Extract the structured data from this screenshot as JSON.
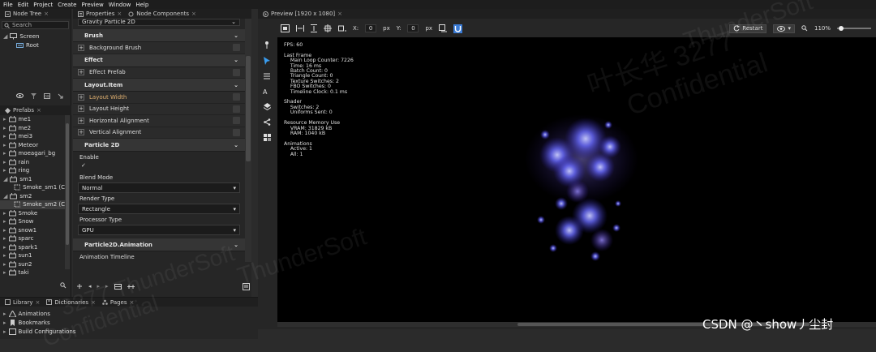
{
  "menubar": {
    "items": [
      "File",
      "Edit",
      "Project",
      "Create",
      "Preview",
      "Window",
      "Help"
    ]
  },
  "nodetree": {
    "tab_label": "Node Tree",
    "search_placeholder": "Search",
    "items": [
      "Screen",
      "Root"
    ]
  },
  "prefabs": {
    "tab_label": "Prefabs",
    "items": [
      {
        "label": "me1",
        "indent": 0
      },
      {
        "label": "me2",
        "indent": 0
      },
      {
        "label": "mei3",
        "indent": 0
      },
      {
        "label": "Meteor",
        "indent": 0
      },
      {
        "label": "moeagari_bg",
        "indent": 0
      },
      {
        "label": "rain",
        "indent": 0
      },
      {
        "label": "ring",
        "indent": 0
      },
      {
        "label": "sm1",
        "indent": 0
      },
      {
        "label": "Smoke_sm1 (C",
        "indent": 1
      },
      {
        "label": "sm2",
        "indent": 0
      },
      {
        "label": "Smoke_sm2 (C",
        "indent": 1
      },
      {
        "label": "Smoke",
        "indent": 0
      },
      {
        "label": "Snow",
        "indent": 0
      },
      {
        "label": "snow1",
        "indent": 0
      },
      {
        "label": "sparc",
        "indent": 0
      },
      {
        "label": "spark1",
        "indent": 0
      },
      {
        "label": "sun1",
        "indent": 0
      },
      {
        "label": "sun2",
        "indent": 0
      },
      {
        "label": "taki",
        "indent": 0
      }
    ]
  },
  "properties": {
    "tab_label": "Properties",
    "tab2_label": "Node Components",
    "top_select": "Gravity Particle 2D",
    "brush_header": "Brush",
    "background_brush": "Background Brush",
    "effect_header": "Effect",
    "effect_prefab": "Effect Prefab",
    "layout_header": "Layout.Item",
    "layout_rows": [
      "Layout Width",
      "Layout Height",
      "Horizontal Alignment",
      "Vertical Alignment"
    ],
    "particle_header": "Particle 2D",
    "enable_label": "Enable",
    "enable_check": "✓",
    "blend_label": "Blend Mode",
    "blend_value": "Normal",
    "render_label": "Render Type",
    "render_value": "Rectangle",
    "processor_label": "Processor Type",
    "processor_value": "GPU",
    "anim_header": "Particle2D.Animation",
    "anim_timeline": "Animation Timeline"
  },
  "bottom": {
    "tabs": [
      "Library",
      "Dictionaries",
      "Pages"
    ],
    "items": [
      "Animations",
      "Bookmarks",
      "Build Configurations"
    ]
  },
  "preview": {
    "tab_label": "Preview [1920 x 1080]",
    "x_label": "X:",
    "x_value": "0",
    "x_unit": "px",
    "y_label": "Y:",
    "y_value": "0",
    "y_unit": "px",
    "restart_label": "Restart",
    "zoom": "110%",
    "zoom_level": 0.12,
    "stats": "FPS: 60\n\nLast Frame\n    Main Loop Counter: 7226\n    Time: 16 ms\n    Batch Count: 0\n    Triangle Count: 0\n    Texture Switches: 2\n    FBO Switches: 0\n    Timeline Clock: 0.1 ms\n\nShader\n    Switches: 2\n    Uniforms Sent: 0\n\nResource Memory Use\n    VRAM: 31829 kB\n    RAM: 1040 kB\n\nAnimations\n    Active: 1\n    All: 1"
  },
  "watermark": {
    "cn": "叶长华 3277",
    "line1": "Confidential",
    "line2": "ThunderSoft",
    "line3": "3277 ThunderSoft",
    "corner": "CSDN @丶show丿尘封"
  },
  "colors": {
    "accent": "#3a7bd5",
    "canvas": "#000000",
    "panel": "#262626",
    "particle": "#5a5cff"
  }
}
